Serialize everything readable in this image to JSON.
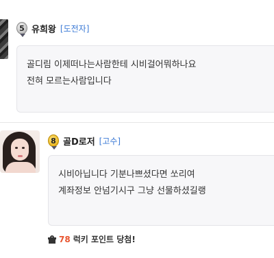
{
  "comments": [
    {
      "level": "5",
      "username": "유희왕",
      "grade": "[도전자]",
      "lines": [
        "골디림 이제떠나는사람한테 시비걸어뭐하나요",
        "전혀 모르는사람입니다"
      ]
    },
    {
      "level": "8",
      "username": "골D로저",
      "grade": "[고수]",
      "lines": [
        "시비아닙니다 기분나쁘셨다면 쏘리여",
        "계좌정보 안넘기시구 그냥 선물하셨길랭"
      ],
      "lucky": {
        "points": "78",
        "label": "럭키 포인트 당첨!"
      }
    }
  ],
  "icons": {
    "level_badge_1": "silver-medal-icon",
    "level_badge_2": "gold-medal-icon",
    "gift": "gift-icon"
  },
  "colors": {
    "grade": "#3d7bd6",
    "points": "#e8542f",
    "bubble_bg": "#f7f7f9"
  }
}
